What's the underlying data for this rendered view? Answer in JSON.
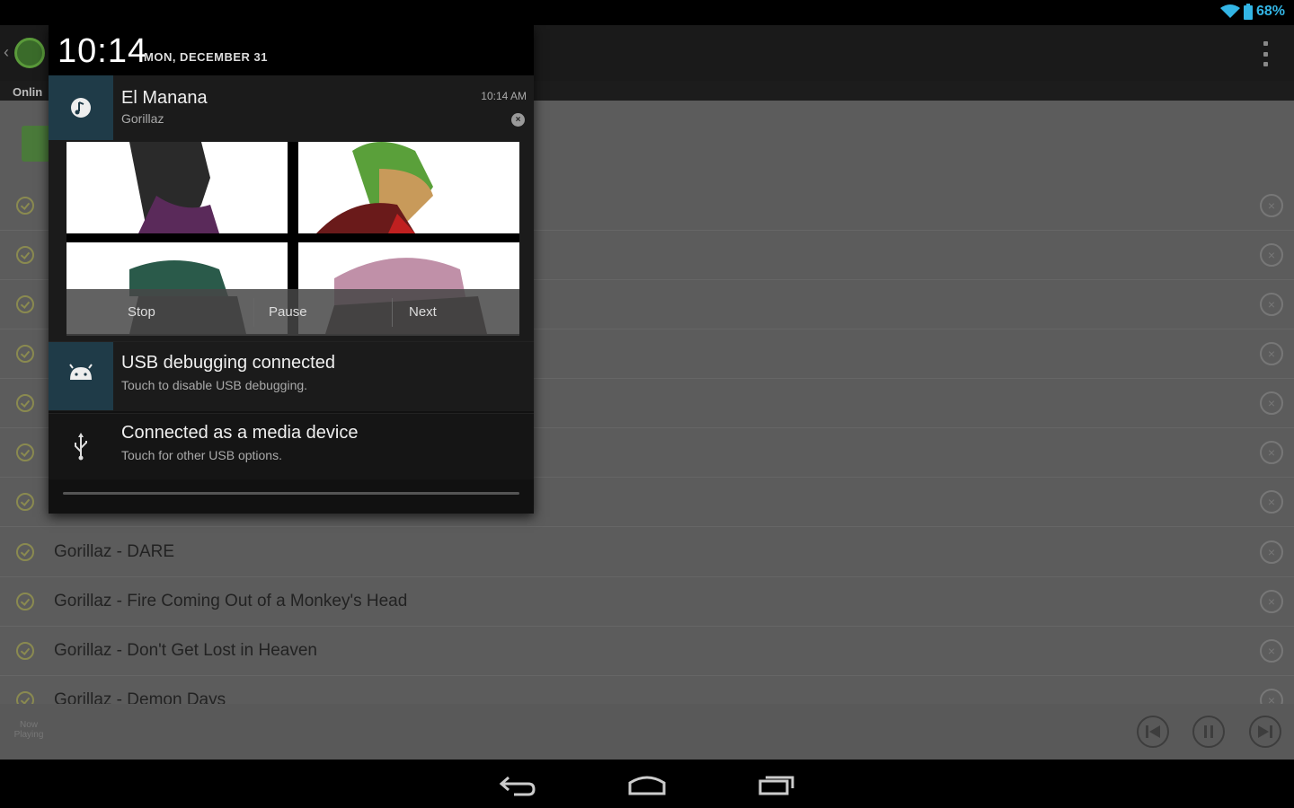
{
  "status": {
    "battery": "68%"
  },
  "app": {
    "tab_label": "Onlin"
  },
  "list": [
    {
      "title": "",
      "y": 0
    },
    {
      "title": "Gorillaz - DARE"
    },
    {
      "title": "Gorillaz - Fire Coming Out of a Monkey's Head"
    },
    {
      "title": "Gorillaz - Don't Get Lost in Heaven"
    },
    {
      "title": "Gorillaz - Demon Days"
    }
  ],
  "now_playing": {
    "label": "Now Playing"
  },
  "shade": {
    "time": "10:14",
    "date": "MON, DECEMBER 31",
    "music": {
      "title": "El Manana",
      "artist": "Gorillaz",
      "timestamp": "10:14 AM",
      "controls": {
        "stop": "Stop",
        "pause": "Pause",
        "next": "Next"
      }
    },
    "usb_debug": {
      "title": "USB debugging connected",
      "subtitle": "Touch to disable USB debugging."
    },
    "media_device": {
      "title": "Connected as a media device",
      "subtitle": "Touch for other USB options."
    }
  },
  "colors": {
    "accent": "#33b5e5",
    "icon_cell": "#1f3b48"
  }
}
